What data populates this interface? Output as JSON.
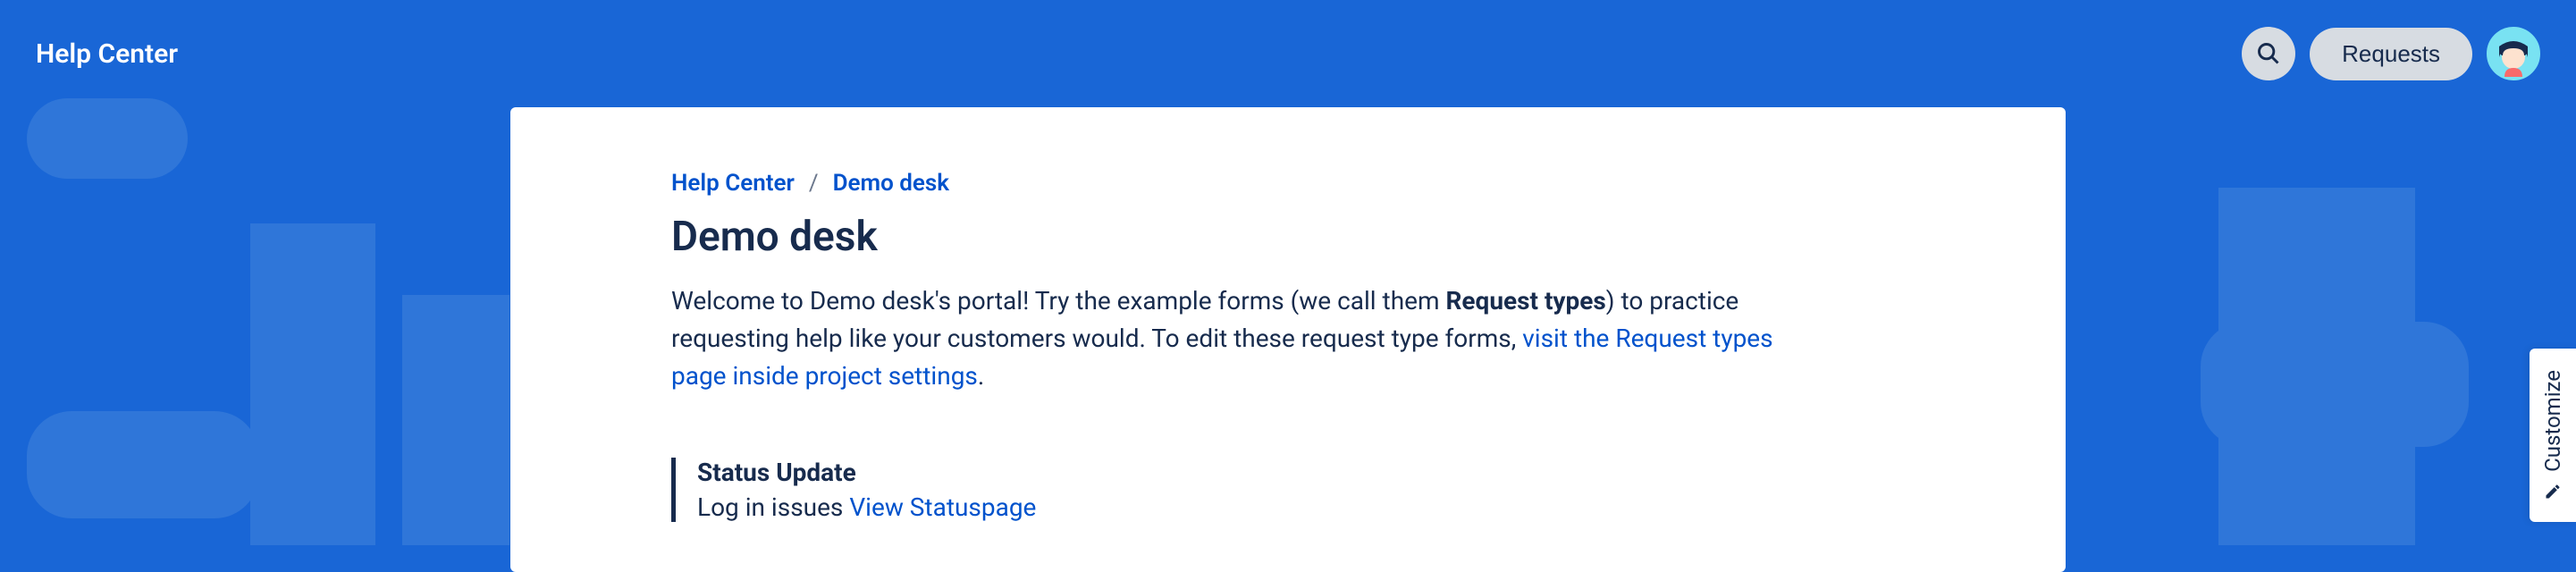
{
  "header": {
    "title": "Help Center",
    "requests_label": "Requests"
  },
  "breadcrumb": {
    "items": [
      "Help Center",
      "Demo desk"
    ],
    "separator": "/"
  },
  "page": {
    "title": "Demo desk",
    "desc_part1": "Welcome to Demo desk's portal! Try the example forms (we call them ",
    "desc_bold": "Request types",
    "desc_part2": ") to practice requesting help like your customers would. To edit these request type forms, ",
    "desc_link": "visit the Request types page inside project settings",
    "desc_part3": "."
  },
  "status": {
    "title": "Status Update",
    "body": "Log in issues ",
    "link": "View Statuspage"
  },
  "customize": {
    "label": "Customize"
  }
}
